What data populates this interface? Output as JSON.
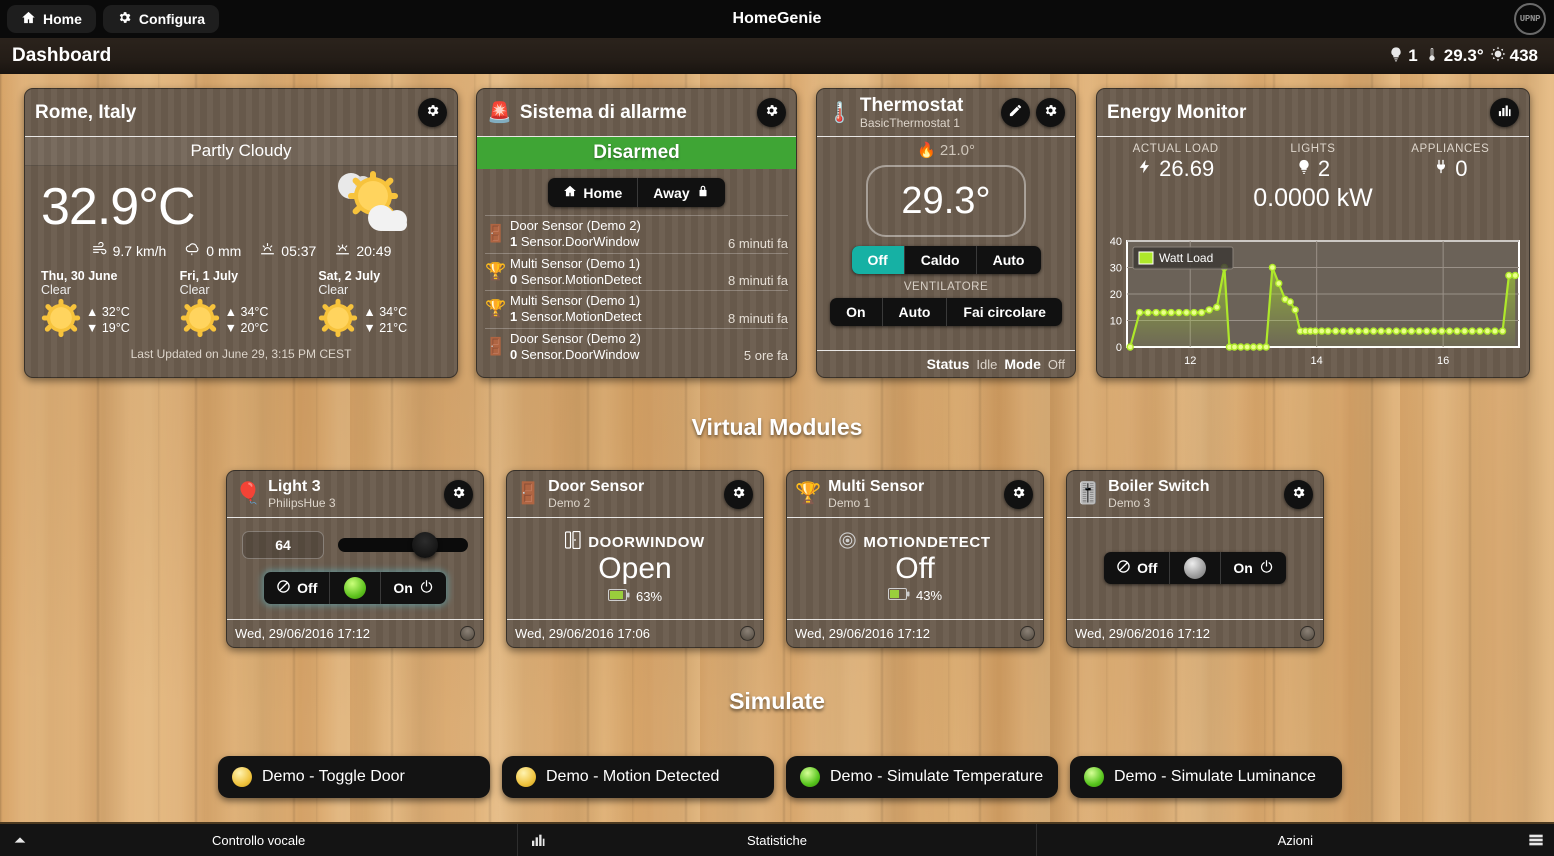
{
  "header": {
    "home_label": "Home",
    "config_label": "Configura",
    "app_title": "HomeGenie",
    "logo_text": "UPNP"
  },
  "titlebar": {
    "page_title": "Dashboard",
    "status": {
      "lights_count": "1",
      "temperature": "29.3°",
      "luminance": "438"
    }
  },
  "weather": {
    "title": "Rome, Italy",
    "condition": "Partly Cloudy",
    "temperature": "32.9°C",
    "wind": "9.7 km/h",
    "rain": "0 mm",
    "sunrise": "05:37",
    "sunset": "20:49",
    "forecast": [
      {
        "day": "Thu, 30 June",
        "cond": "Clear",
        "high": "32°C",
        "low": "19°C"
      },
      {
        "day": "Fri, 1 July",
        "cond": "Clear",
        "high": "34°C",
        "low": "20°C"
      },
      {
        "day": "Sat, 2 July",
        "cond": "Clear",
        "high": "34°C",
        "low": "21°C"
      }
    ],
    "updated": "Last Updated on June 29, 3:15 PM CEST"
  },
  "alarm": {
    "title": "Sistema di allarme",
    "state": "Disarmed",
    "home_label": "Home",
    "away_label": "Away",
    "events": [
      {
        "name": "Door Sensor (Demo 2)",
        "value": "1",
        "param": "Sensor.DoorWindow",
        "age": "6 minuti fa",
        "icon": "door"
      },
      {
        "name": "Multi Sensor (Demo 1)",
        "value": "0",
        "param": "Sensor.MotionDetect",
        "age": "8 minuti fa",
        "icon": "multi"
      },
      {
        "name": "Multi Sensor (Demo 1)",
        "value": "1",
        "param": "Sensor.MotionDetect",
        "age": "8 minuti fa",
        "icon": "multi"
      },
      {
        "name": "Door Sensor (Demo 2)",
        "value": "0",
        "param": "Sensor.DoorWindow",
        "age": "5 ore fa",
        "icon": "door"
      }
    ]
  },
  "thermostat": {
    "title": "Thermostat",
    "subtitle": "BasicThermostat 1",
    "setpoint": "21.0°",
    "current": "29.3°",
    "modes": [
      "Off",
      "Caldo",
      "Auto"
    ],
    "active_mode": "Off",
    "fan_label": "VENTILATORE",
    "fan_modes": [
      "On",
      "Auto",
      "Fai circolare"
    ],
    "status_label": "Status",
    "status_value": "Idle",
    "mode_label": "Mode",
    "mode_value": "Off"
  },
  "energy": {
    "title": "Energy Monitor",
    "actual_load_label": "ACTUAL LOAD",
    "actual_load_value": "26.69",
    "lights_label": "LIGHTS",
    "lights_value": "2",
    "appliances_label": "APPLIANCES",
    "appliances_value": "0",
    "total": "0.0000 kW"
  },
  "chart_data": {
    "type": "line",
    "title": "",
    "legend": [
      "Watt Load"
    ],
    "legend_position": "top-left",
    "legend_color": "#aee82a",
    "xlabel": "",
    "ylabel": "",
    "xlim": [
      11.0,
      17.2
    ],
    "ylim": [
      0,
      40
    ],
    "yticks": [
      0,
      10,
      20,
      30,
      40
    ],
    "xticks": [
      12,
      14,
      16
    ],
    "grid": true,
    "series": [
      {
        "name": "Watt Load",
        "color": "#aee82a",
        "x": [
          11.05,
          11.2,
          11.33,
          11.46,
          11.58,
          11.7,
          11.82,
          11.94,
          12.06,
          12.18,
          12.3,
          12.42,
          12.54,
          12.62,
          12.7,
          12.8,
          12.9,
          13.0,
          13.1,
          13.2,
          13.3,
          13.4,
          13.5,
          13.58,
          13.66,
          13.74,
          13.82,
          13.9,
          13.98,
          14.08,
          14.18,
          14.3,
          14.42,
          14.54,
          14.66,
          14.78,
          14.9,
          15.02,
          15.14,
          15.26,
          15.38,
          15.5,
          15.62,
          15.74,
          15.86,
          15.98,
          16.1,
          16.22,
          16.34,
          16.46,
          16.58,
          16.7,
          16.82,
          16.94,
          17.04,
          17.14
        ],
        "y": [
          0,
          13,
          13,
          13,
          13,
          13,
          13,
          13,
          13,
          13,
          14,
          15,
          30,
          0,
          0,
          0,
          0,
          0,
          0,
          0,
          30,
          24,
          18,
          17,
          14,
          6,
          6,
          6,
          6,
          6,
          6,
          6,
          6,
          6,
          6,
          6,
          6,
          6,
          6,
          6,
          6,
          6,
          6,
          6,
          6,
          6,
          6,
          6,
          6,
          6,
          6,
          6,
          6,
          6,
          27,
          27
        ]
      }
    ]
  },
  "sections": {
    "virtual_modules": "Virtual Modules",
    "simulate": "Simulate"
  },
  "modules": [
    {
      "title": "Light 3",
      "subtitle": "PhilipsHue 3",
      "icon": "bulbs",
      "type": "dimmer",
      "level": "64",
      "off_label": "Off",
      "on_label": "On",
      "state": "on",
      "timestamp": "Wed, 29/06/2016 17:12"
    },
    {
      "title": "Door Sensor",
      "subtitle": "Demo 2",
      "icon": "door",
      "type": "sensor",
      "sensor_label": "DOORWINDOW",
      "sensor_value": "Open",
      "battery": "63%",
      "timestamp": "Wed, 29/06/2016 17:06"
    },
    {
      "title": "Multi Sensor",
      "subtitle": "Demo 1",
      "icon": "multi",
      "type": "sensor",
      "sensor_label": "MOTIONDETECT",
      "sensor_value": "Off",
      "battery": "43%",
      "timestamp": "Wed, 29/06/2016 17:12"
    },
    {
      "title": "Boiler Switch",
      "subtitle": "Demo 3",
      "icon": "switch",
      "type": "switch",
      "off_label": "Off",
      "on_label": "On",
      "state": "off",
      "timestamp": "Wed, 29/06/2016 17:12"
    }
  ],
  "simulate_buttons": [
    {
      "label": "Demo - Toggle Door",
      "led": "y"
    },
    {
      "label": "Demo - Motion Detected",
      "led": "y"
    },
    {
      "label": "Demo - Simulate Temperature",
      "led": "g"
    },
    {
      "label": "Demo - Simulate Luminance",
      "led": "g"
    }
  ],
  "footer": {
    "voice_label": "Controllo vocale",
    "stats_label": "Statistiche",
    "actions_label": "Azioni"
  }
}
